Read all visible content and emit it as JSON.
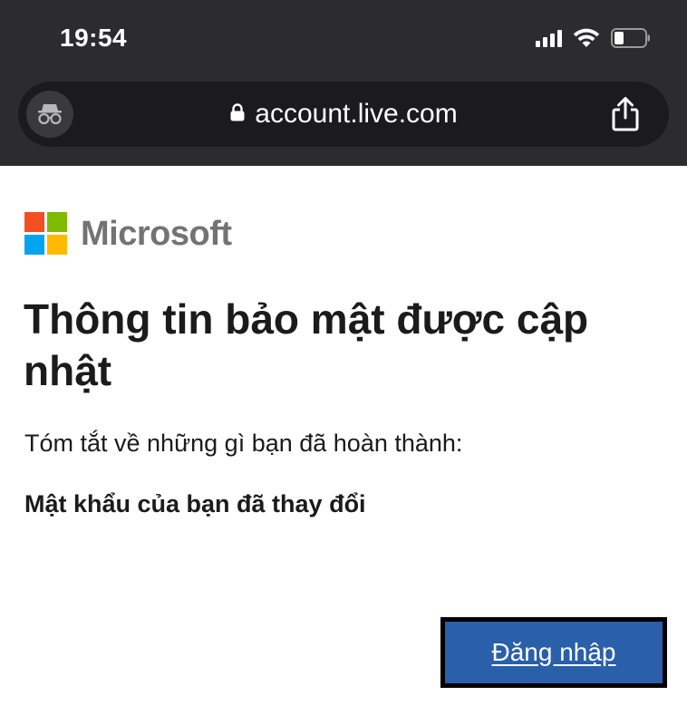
{
  "status_bar": {
    "time": "19:54"
  },
  "browser": {
    "url": "account.live.com",
    "icons": {
      "mode": "incognito-icon",
      "lock": "lock-icon",
      "share": "share-icon"
    }
  },
  "brand": {
    "wordmark": "Microsoft",
    "logo_colors": [
      "#f25022",
      "#7fba00",
      "#00a4ef",
      "#ffb900"
    ]
  },
  "main": {
    "title": "Thông tin bảo mật được cập nhật",
    "summary": "Tóm tắt về những gì bạn đã hoàn thành:",
    "password_changed": "Mật khẩu của bạn đã thay đổi",
    "signin_label": "Đăng nhập"
  },
  "colors": {
    "chrome_bg": "#2c2c2e",
    "button_bg": "#2a5faa",
    "wordmark": "#737373"
  }
}
